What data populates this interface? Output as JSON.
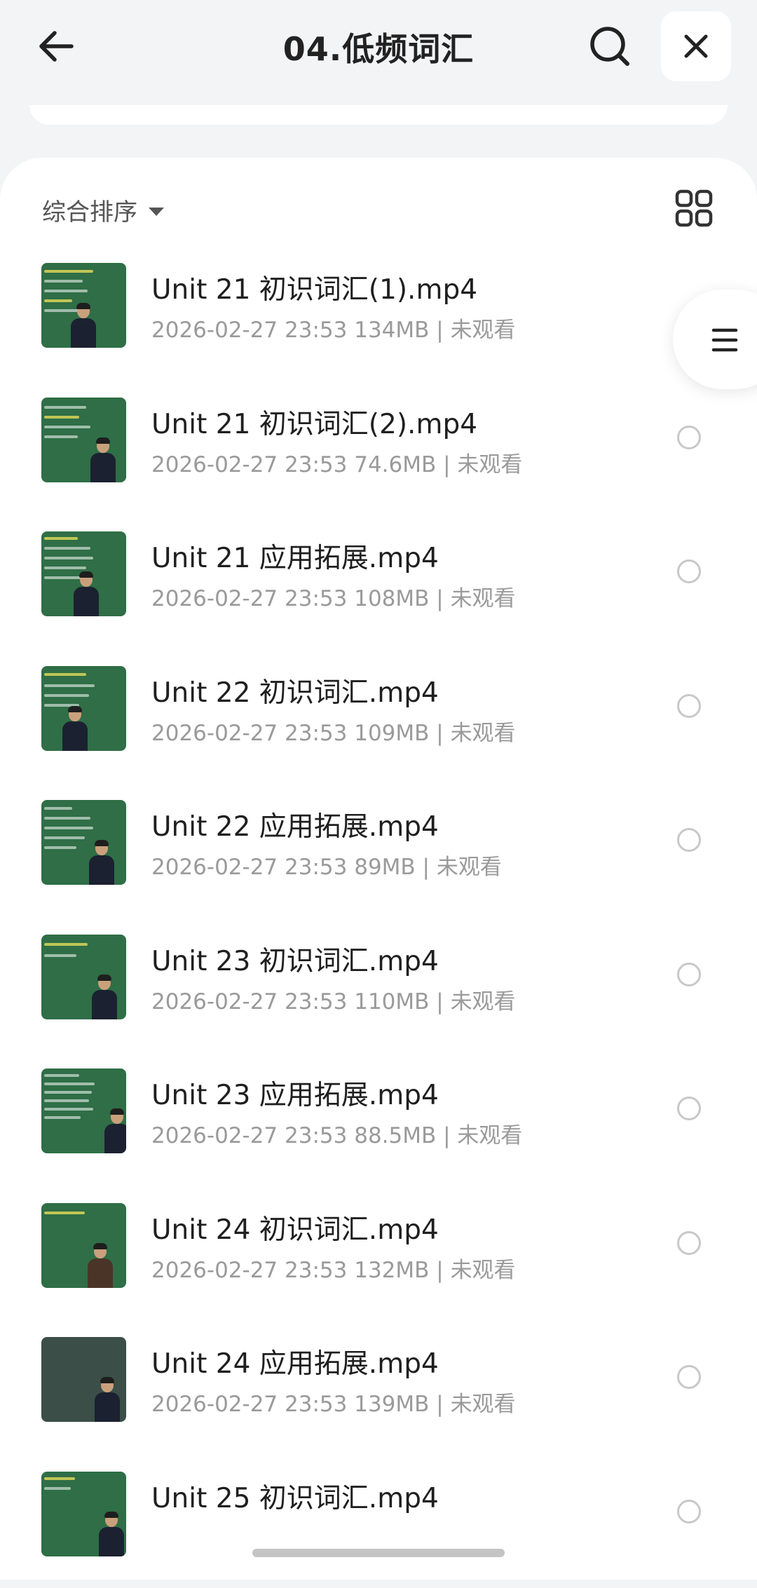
{
  "header": {
    "title": "04.低频词汇",
    "back_icon": "arrow-left-icon",
    "search_icon": "search-icon",
    "close_icon": "close-icon"
  },
  "toolbar": {
    "sort_label": "综合排序",
    "sort_icon": "caret-down-icon",
    "view_icon": "grid-view-icon"
  },
  "floating_button": {
    "icon": "list-menu-icon"
  },
  "files": [
    {
      "name": "Unit 21 初识词汇(1).mp4",
      "date": "2026-02-27 23:53",
      "size": "134MB",
      "status": "未观看",
      "thumb": "green"
    },
    {
      "name": "Unit 21 初识词汇(2).mp4",
      "date": "2026-02-27 23:53",
      "size": "74.6MB",
      "status": "未观看",
      "thumb": "green"
    },
    {
      "name": "Unit 21 应用拓展.mp4",
      "date": "2026-02-27 23:53",
      "size": "108MB",
      "status": "未观看",
      "thumb": "green"
    },
    {
      "name": "Unit 22 初识词汇.mp4",
      "date": "2026-02-27 23:53",
      "size": "109MB",
      "status": "未观看",
      "thumb": "green"
    },
    {
      "name": "Unit 22 应用拓展.mp4",
      "date": "2026-02-27 23:53",
      "size": "89MB",
      "status": "未观看",
      "thumb": "green"
    },
    {
      "name": "Unit 23 初识词汇.mp4",
      "date": "2026-02-27 23:53",
      "size": "110MB",
      "status": "未观看",
      "thumb": "green"
    },
    {
      "name": "Unit 23 应用拓展.mp4",
      "date": "2026-02-27 23:53",
      "size": "88.5MB",
      "status": "未观看",
      "thumb": "green"
    },
    {
      "name": "Unit 24 初识词汇.mp4",
      "date": "2026-02-27 23:53",
      "size": "132MB",
      "status": "未观看",
      "thumb": "green"
    },
    {
      "name": "Unit 24 应用拓展.mp4",
      "date": "2026-02-27 23:53",
      "size": "139MB",
      "status": "未观看",
      "thumb": "dark"
    },
    {
      "name": "Unit 25 初识词汇.mp4",
      "date": "",
      "size": "",
      "status": "",
      "thumb": "green"
    }
  ],
  "colors": {
    "background": "#f3f4f6",
    "panel": "#ffffff",
    "title": "#222222",
    "meta_text": "#9a9a9a",
    "radio_border": "#c8c8c8",
    "thumb_green": "#2f6e46"
  }
}
